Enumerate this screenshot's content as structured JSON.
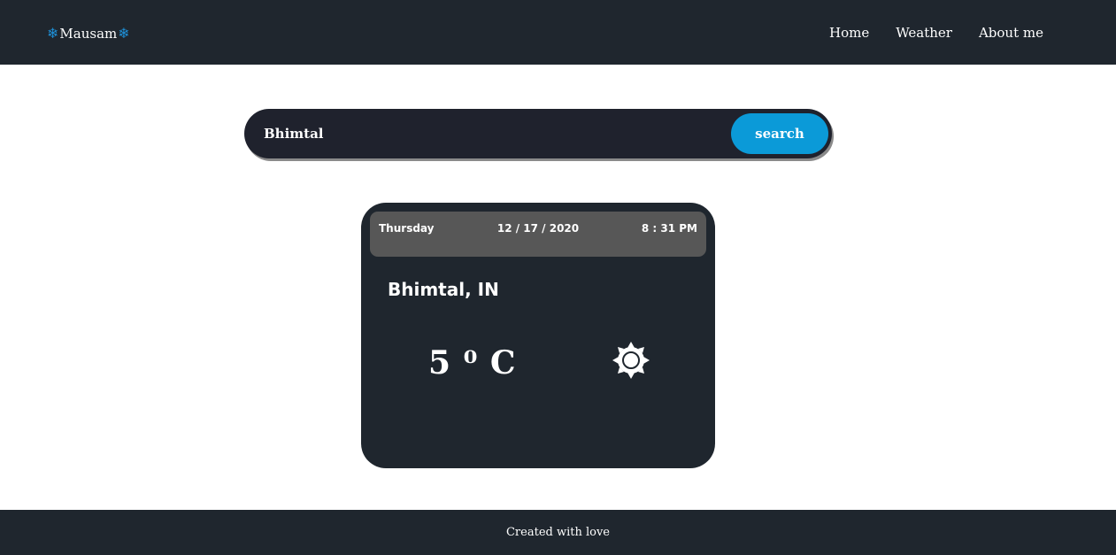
{
  "brand": {
    "name": "Mausam",
    "icon": "snowflake-icon",
    "icon_color": "#1e8fd6"
  },
  "nav": {
    "links": [
      {
        "label": "Home"
      },
      {
        "label": "Weather"
      },
      {
        "label": "About me"
      }
    ]
  },
  "search": {
    "value": "Bhimtal",
    "button_label": "search",
    "button_color": "#0b9ad8"
  },
  "weather": {
    "day": "Thursday",
    "date": "12 / 17 / 2020",
    "time": "8 : 31 PM",
    "location": "Bhimtal, IN",
    "temperature": "5 ⁰ C",
    "condition_icon": "sun-icon"
  },
  "footer": {
    "text": "Created with love"
  },
  "colors": {
    "dark": "#1f262e",
    "header_gray": "#575757"
  }
}
